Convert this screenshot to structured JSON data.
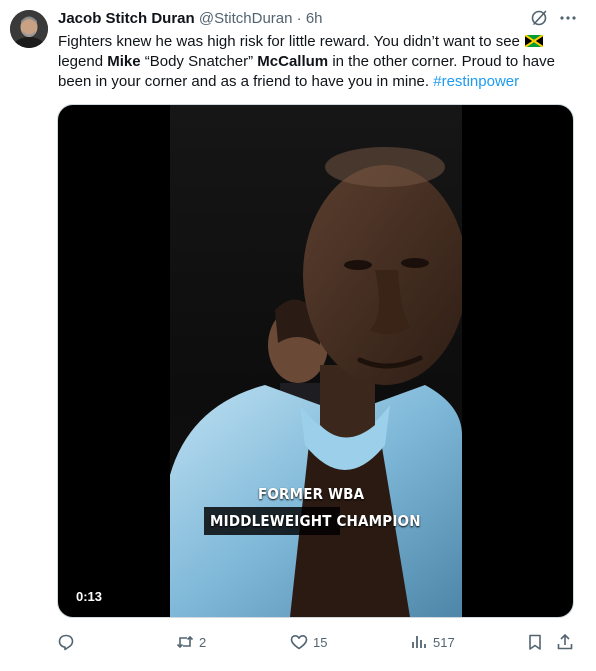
{
  "author": {
    "name": "Jacob Stitch Duran",
    "handle": "@StitchDuran",
    "separator": "·",
    "time": "6h"
  },
  "tweet": {
    "part1": "Fighters knew he was high risk for little reward. You didn’t want to see ",
    "part2": " legend ",
    "bold1": "Mike",
    "part3": " “Body Snatcher” ",
    "bold2": "McCallum",
    "part4": " in the other corner. Proud to have been in your corner and as a friend to have you in mine. ",
    "hashtag": "#restinpower",
    "flag_icon": "jamaica-flag-icon"
  },
  "video": {
    "caption_line1": "FORMER WBA",
    "caption_line2_a": "MIDDLEWEIGHT",
    "caption_line2_b": " CHAMPION",
    "duration": "0:13"
  },
  "actions": {
    "reply_icon": "reply-icon",
    "retweet_count": "2",
    "like_count": "15",
    "views_count": "517",
    "bookmark_icon": "bookmark-icon",
    "share_icon": "share-icon"
  },
  "colors": {
    "text": "#0f1419",
    "secondary": "#536471",
    "link": "#1d9bf0"
  }
}
